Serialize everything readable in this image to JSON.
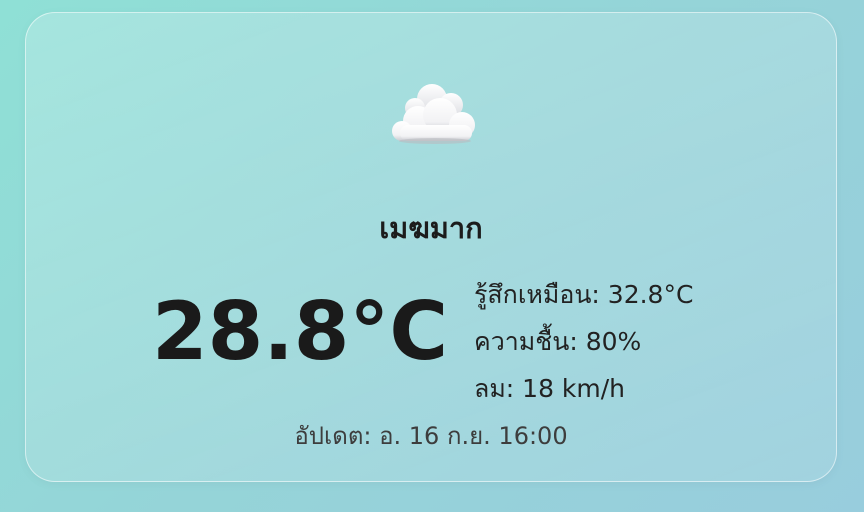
{
  "weather": {
    "icon": "cloud-icon",
    "condition": "เมฆมาก",
    "temperature": "28.8°C",
    "feels_like": "รู้สึกเหมือน: 32.8°C",
    "humidity": "ความชื้น: 80%",
    "wind": "ลม: 18 km/h",
    "updated": "อัปเดต: อ. 16 ก.ย. 16:00"
  }
}
